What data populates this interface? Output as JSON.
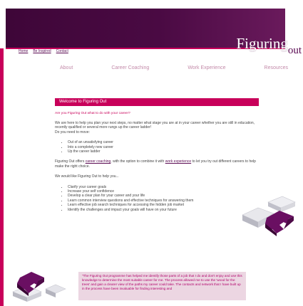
{
  "brand": {
    "logo_main": "Figuring",
    "logo_out": "out"
  },
  "top_nav": [
    "Home",
    "Be Inspired",
    "Contact"
  ],
  "main_nav": [
    "About",
    "Career Coaching",
    "Work Experience",
    "Resources"
  ],
  "welcome": {
    "title": "Welcome to Figuring Out",
    "question": "Are you Figuring Out what to do with your career?",
    "intro": "We are here to help you plan your next steps, no matter what stage you are at in your career whether you are still in education, recently qualified or several more rungs up the career ladder!",
    "need_prompt": "Do you need to move:",
    "moves": [
      "Out of an unsatisfying career",
      "Into a completely new career",
      "Up the career ladder"
    ],
    "offer_before": "Figuring Out offers ",
    "offer_link1": "career coaching",
    "offer_middle": ", with the option to combine it with ",
    "offer_link2": "work experience",
    "offer_after": " to let you try out different careers to help make the right choice.",
    "help_prompt": "We would like Figuring Out to help you...",
    "helps": [
      "Clarify your career goals",
      "Increase your self confidence",
      "Develop a clear plan for your career and your life",
      "Learn common interview questions and effective techniques for answering them",
      "Learn effective job search techniques for accessing the hidden job market",
      "Identify the challenges and impact your goals will have on your future"
    ]
  },
  "testimonial": "\"The Figuring Out programme has helped me identify those parts of a job that I do and don't enjoy and use this knowledge to determine the most suitable career for me. The process allowed me to use the 'wood for the trees' and gain a clearer view of the paths my career could take. The contacts and network that I have built up in the process have been invaluable for finding interesting and",
  "colors": {
    "header": "#4a0a43",
    "accent": "#c8005a",
    "nav_text": "#c38aa9"
  }
}
